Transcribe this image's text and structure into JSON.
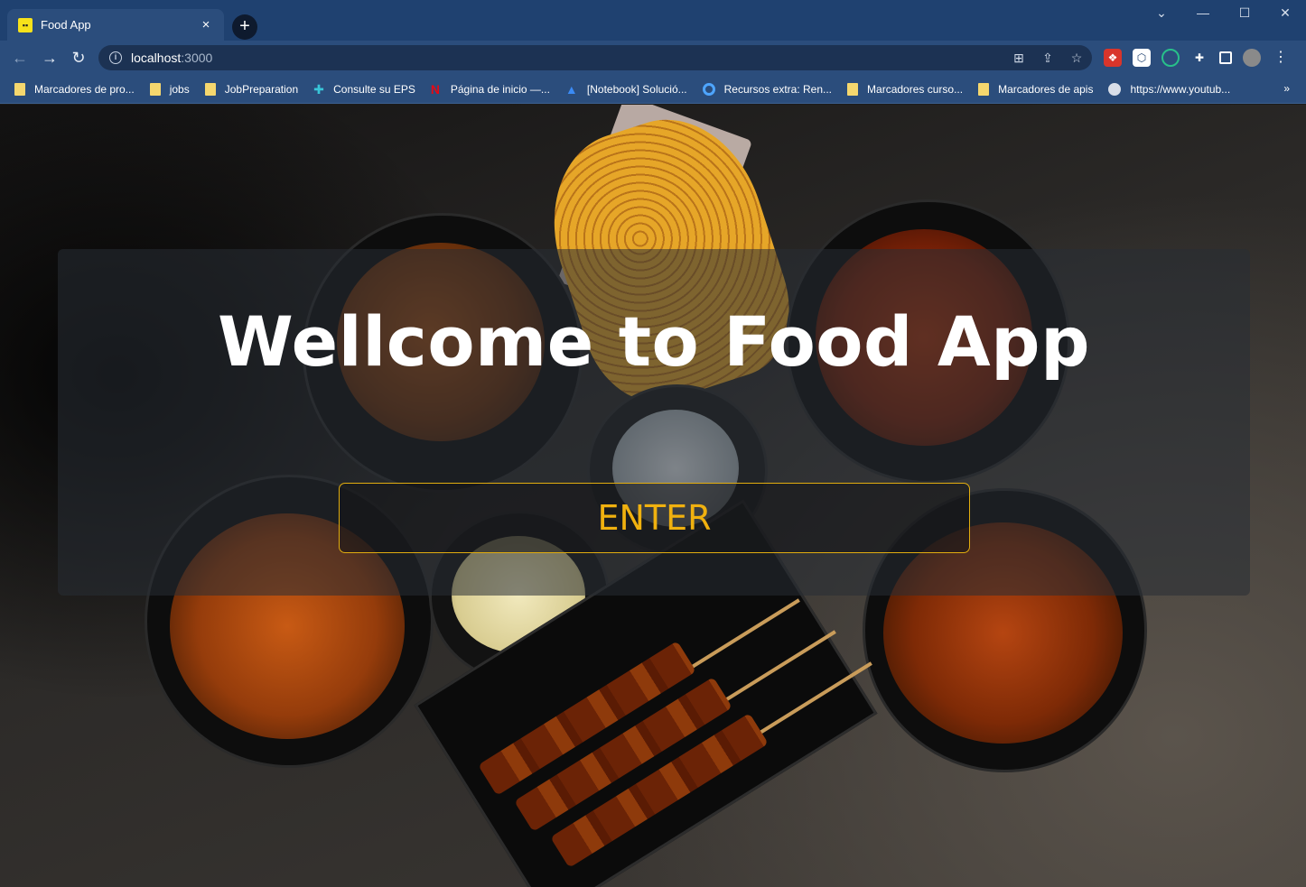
{
  "browser": {
    "tab": {
      "title": "Food App",
      "favicon": "food-app-favicon",
      "close": "×"
    },
    "new_tab": "+",
    "window_controls": {
      "collapse": "⌄",
      "minimize": "—",
      "maximize": "☐",
      "close": "✕"
    },
    "nav": {
      "back": "←",
      "forward": "→",
      "reload": "↻"
    },
    "address": {
      "host": "localhost",
      "port": ":3000"
    },
    "bookmarks": [
      {
        "label": "Marcadores de pro...",
        "icon": "folder-icon"
      },
      {
        "label": "jobs",
        "icon": "folder-icon"
      },
      {
        "label": "JobPreparation",
        "icon": "folder-icon"
      },
      {
        "label": "Consulte su EPS",
        "icon": "plus-cross-icon"
      },
      {
        "label": "Página de inicio —...",
        "icon": "netflix-icon"
      },
      {
        "label": "[Notebook] Solució...",
        "icon": "triangle-logo-icon"
      },
      {
        "label": "Recursos extra: Ren...",
        "icon": "circle-logo-icon"
      },
      {
        "label": "Marcadores curso...",
        "icon": "folder-icon"
      },
      {
        "label": "Marcadores de apis",
        "icon": "folder-icon"
      },
      {
        "label": "https://www.youtub...",
        "icon": "globe-icon"
      }
    ],
    "bookmarks_more": "»"
  },
  "page": {
    "heading": "Wellcome to Food App",
    "enter_button": "ENTER"
  },
  "colors": {
    "chrome_dark": "#1f4170",
    "chrome": "#2b4d7c",
    "accent_yellow": "#f0b10f",
    "heading_white": "#ffffff"
  }
}
